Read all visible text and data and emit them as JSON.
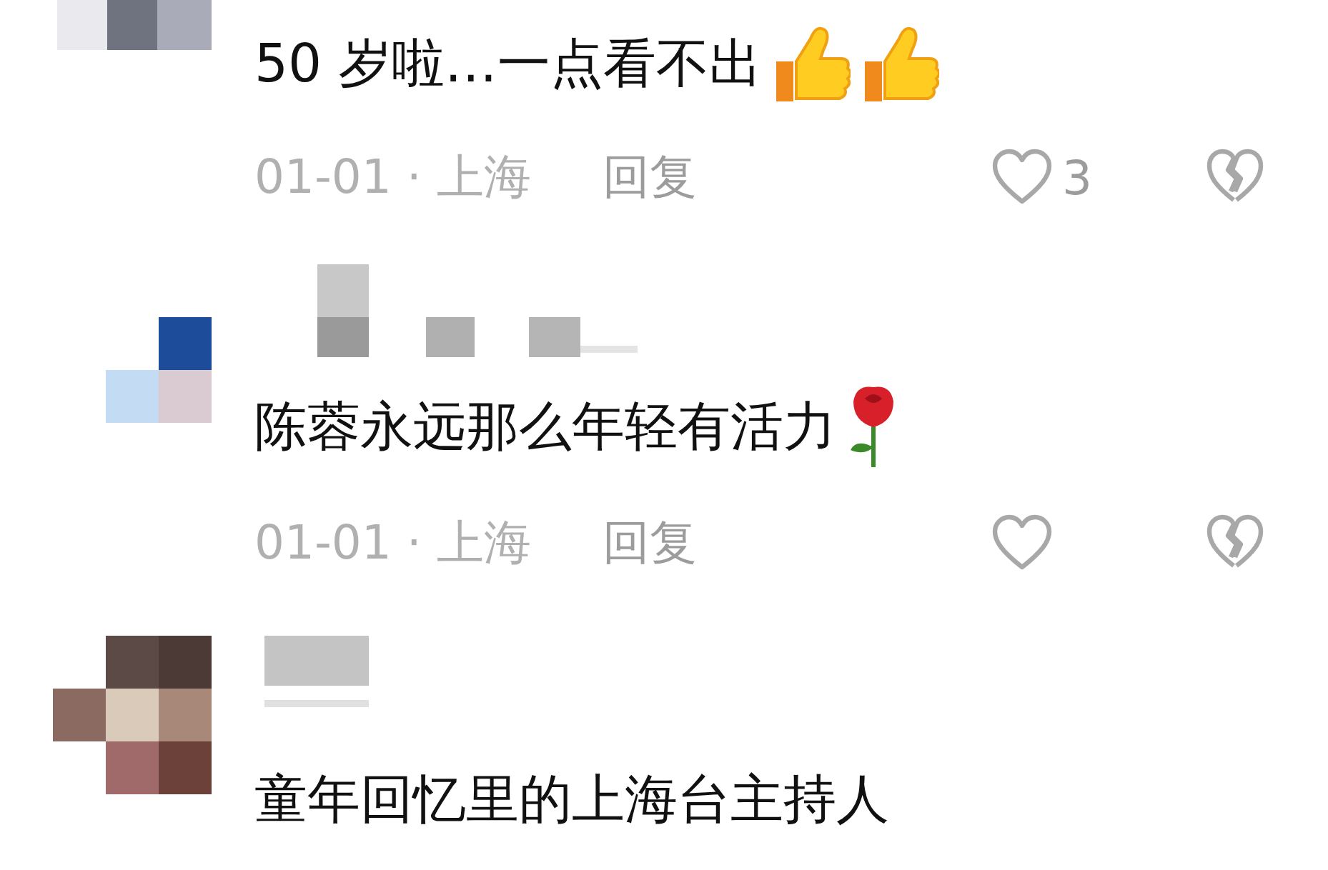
{
  "comments": [
    {
      "blurred_name": false,
      "text": "50 岁啦…一点看不出",
      "emojis": [
        {
          "kind": "thumbs-up"
        },
        {
          "kind": "thumbs-up"
        }
      ],
      "meta": "01-01 · 上海",
      "reply": "回复",
      "likes": "3"
    },
    {
      "blurred_name": true,
      "text": "陈蓉永远那么年轻有活力",
      "emojis": [
        {
          "kind": "rose"
        }
      ],
      "meta": "01-01 · 上海",
      "reply": "回复"
    },
    {
      "blurred_name": true,
      "text": "童年回忆里的上海台主持人"
    }
  ]
}
